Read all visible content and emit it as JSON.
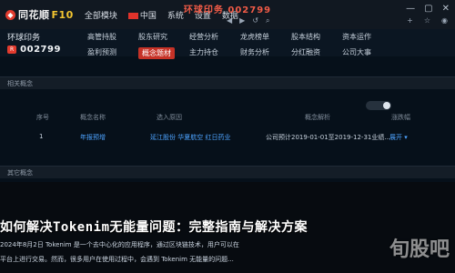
{
  "top_menu": [
    "全部模块",
    "中国",
    "系统",
    "设置",
    "数据"
  ],
  "app_title": "环球印务 002799",
  "window_controls": [
    "—",
    "▢",
    "✕"
  ],
  "small_icons": [
    "◀",
    "▶",
    "↺",
    "⌕"
  ],
  "right_tools": [
    "+",
    "☆",
    "◉"
  ],
  "ticker": {
    "name": "环球印务",
    "badge": "R",
    "code": "002799"
  },
  "nav": [
    "高管持股",
    "股东研究",
    "经营分析",
    "龙虎榜单",
    "股本结构",
    "资本运作",
    "盈利预测",
    "概念题材",
    "主力持仓",
    "财务分析",
    "分红融资",
    "公司大事"
  ],
  "nav_active_index": 7,
  "panel1_label": "相关概念",
  "table": {
    "headers": [
      "序号",
      "概念名称",
      "选入原因",
      "概念解析",
      "涨跌幅"
    ],
    "rows": [
      [
        "1",
        "年报预增",
        "延江股份 华夏航空 红日药业",
        "公司预计2019-01-01至2019-12-31业绩...",
        "展开 ▾"
      ]
    ]
  },
  "panel2_label": "其它概念",
  "overlay_title": "如何解决Tokenim无能量问题：完整指南与解决方案",
  "overlay_lines": [
    "2024年8月2日 Tokenim 是一个去中心化的应用程序，通过区块链技术，用户可以在",
    "平台上进行交易。然而，很多用户在使用过程中，会遇到 Tokenim 无能量的问题..."
  ],
  "watermark": "旬股吧"
}
